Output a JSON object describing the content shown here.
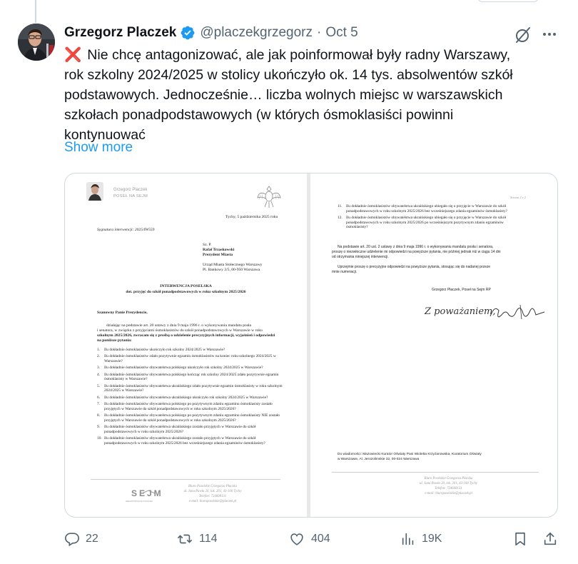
{
  "tweet": {
    "author_name": "Grzegorz Placzek",
    "handle": "@placzekgrzegorz",
    "separator": "·",
    "date": "Oct 5",
    "cross_mark": "❌",
    "text_lines": [
      "Nie chcę antagonizować, ale jak poinformował były radny Warszawy,",
      "rok szkolny 2024/2025 w stolicy ukończyło ok. 14 tys. absolwentów szkół",
      "podstawowych. Jednocześnie… liczba wolnych miejsc w warszawskich",
      "szkołach ponadpodstawowych (w których ósmoklasiści powinni",
      "kontynuować"
    ],
    "show_more": "Show more"
  },
  "actions": {
    "replies": "22",
    "reposts": "114",
    "likes": "404",
    "views": "19K"
  },
  "icons": {
    "verified": "verified-badge-icon",
    "grok": "grok-icon",
    "more": "more-icon",
    "reply": "reply-icon",
    "repost": "repost-icon",
    "like": "heart-icon",
    "views": "views-icon",
    "bookmark": "bookmark-icon",
    "share": "share-icon"
  },
  "colors": {
    "accent": "#1d9bf0",
    "muted": "#536471",
    "cross": "#dd2e44"
  },
  "document": {
    "page1": {
      "letterhead_name": "Grzegorz Placzek",
      "letterhead_title": "POSEŁ NA SEJM",
      "place_date": "Tychy, 5 października 2025 roku",
      "signature_ref": "Sygnatura interwencji: 2025/IW559",
      "recipient": [
        "Sz. P.",
        "Rafał Trzaskowski",
        "Prezydent Miasta",
        "",
        "Urząd Miasta Stołecznego Warszawy",
        "Pl. Bankowy 3/5, 00-950 Warszawa"
      ],
      "title": "INTERWENCJA POSELSKA",
      "subtitle": "dot. przyjęć do szkół ponadpodstawowych w roku szkolnym 2025/2026",
      "salutation": "Szanowny Panie Prezydencie,",
      "intro": [
        "działając na podstawie art. 20 ustawy z dnia 9 maja 1996 r. o wykonywaniu mandatu posła",
        "i senatora, w związku z przyjęciami ósmoklasistów do szkół ponadpodstawowych w Warszawie w roku",
        "szkolnym 2025/2026, zwracam się z prośbą o udzielenie precyzyjnych informacji, wyjaśnień i odpowiedzi",
        "na poniższe pytania:"
      ],
      "questions": [
        "Ilu dokładnie ósmoklasistów ukończyło rok szkolny 2024/2025 w Warszawie?",
        "Ilu dokładnie ósmoklasistów zdało pozytywnie egzamin ósmoklasistów na koniec roku szkolnego 2024/2025 w Warszawie?",
        "Ilu dokładnie ósmoklasistów obywatelstwa polskiego ukończyło rok szkolny 2024/2025 w Warszawie?",
        "Ilu dokładnie ósmoklasistów obywatelstwa polskiego kończąc rok szkolny 2024/2025 zdało pozytywnie egzamin ósmoklasisty w Warszawie?",
        "Ilu dokładnie ósmoklasistów obywatelstwa ukraińskiego zdało pozytywnie egzamin ósmoklasisty w roku szkolnym 2024/2025 w Warszawie?",
        "Ilu dokładnie ósmoklasistów obywatelstwa ukraińskiego ukończyło rok szkolny 2024/2025 w Warszawie?",
        "Ilu dokładnie ósmoklasistów obywatelstwa polskiego po pozytywnym zdaniu egzaminu ósmoklasisty zostało przyjętych w Warszawie do szkół ponadpodstawowych w roku szkolnym 2025/2026?",
        "Ilu dokładnie ósmoklasistów obywatelstwa polskiego po pozytywnym zdaniu egzaminu ósmoklasisty NIE zostało przyjętych w Warszawie do szkół ponadpodstawowych w roku szkolnym 2025/2026?",
        "Ilu dokładnie ósmoklasistów obywatelstwa ukraińskiego zostało przyjętych w Warszawie do szkół ponadpodstawowych w roku szkolnym 2025/2026?",
        "Ilu dokładnie ósmoklasistów obywatelstwa ukraińskiego zostało przyjętych w Warszawie do szkół ponadpodstawowych w roku szkolnym 2025/2026 bez wcześniejszego zdania egzaminów ósmoklasisty?"
      ],
      "footer_logo": "SEJM",
      "footer_logo_sub": "RZECZPOSPOLITEJ POLSKIEJ",
      "footer_lines": [
        "Biuro Poselskie Grzegorza Płaczka",
        "ul. Jana Pawła 20, lok. 201, 43-100 Tychy",
        "Telefon: 724608131",
        "e-mail: biuroposelskie@placzek.pl"
      ]
    },
    "page2": {
      "page_label": "Strona 2 z 2",
      "questions": [
        {
          "num": "11.",
          "text": "Ilu dokładnie ósmoklasistów obywatelstwa ukraińskiego ubiegało się o przyjęcie w Warszawie do szkół ponadpodstawowych w roku szkolnym 2025/2026 bez wcześniejszego zdania egzaminów ósmoklasisty?"
        },
        {
          "num": "12.",
          "text": "Ilu dokładnie ósmoklasistów obywatelstwa ukraińskiego ubiegało się o przyjęcie w Warszawie do szkół ponadpodstawowych w roku szkolnym 2025/2026 po wcześniejszym pozytywnym zdaniu egzaminów ósmoklasisty?"
        }
      ],
      "closing": [
        "Na podstawie art. 20 ust. 2 ustawy z dnia 9 maja 1996 r. o wykonywaniu mandatu posła i senatora,",
        "proszę o niezwłoczne udzielenie mi odpowiedzi na powyższe pytania, nie później jednak niż w ciągu 14 dni",
        "od otrzymania niniejszej interwencji."
      ],
      "request": [
        "Uprzejmie proszę o precyzyjne odpowiedzi na powyższe pytania, stosując się do nadanej przeze",
        "mnie numeracji."
      ],
      "signature_name": "Grzegorz Płaczek, Poseł na Sejm RP",
      "handwritten": "Z poważaniem,",
      "cc": [
        "Do wiadomości: Mazowiecki Kurator Oświaty Pani Wioletta Krzyżanowska, Kuratorium Oświaty",
        "w Warszawie, Al. Jerozolimskie 32, 00-024 Warszawa"
      ],
      "footer_lines": [
        "Biuro Poselskie Grzegorza Płaczka",
        "ul. Jana Pawła 20, lok. 201, 43-100 Tychy",
        "Telefon: 724608131",
        "e-mail: biuroposelskie@placzek.pl"
      ]
    }
  }
}
